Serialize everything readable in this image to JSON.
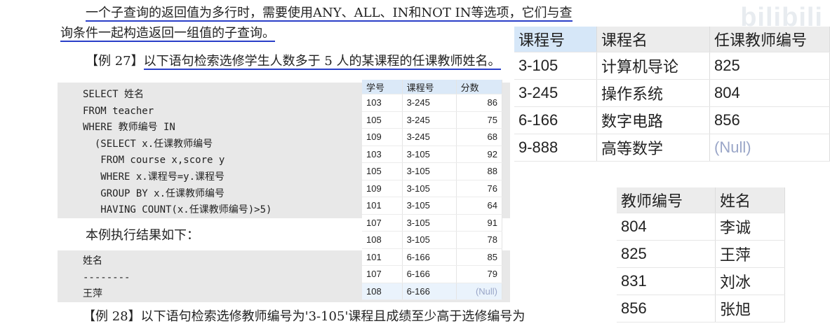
{
  "doc": {
    "para1_line1_a": "一个子查询的返回值为多行时，需要使用",
    "para1_line1_b": "ANY、ALL、IN和NOT IN",
    "para1_line1_c": "等选项，它们与查",
    "para1_line2": "询条件一起构造返回一组值的子查询。",
    "example_label": "【例 27】",
    "example_text": "以下语句检索选修学生人数多于 5 人的某课程的任课教师姓名。",
    "sql_lines": [
      "SELECT 姓名",
      "FROM teacher",
      "WHERE 教师编号 IN",
      "  (SELECT x.任课教师编号",
      "   FROM course x,score y",
      "   WHERE x.课程号=y.课程号",
      "   GROUP BY x.任课教师编号",
      "   HAVING COUNT(x.任课教师编号)>5)"
    ],
    "result_intro": "本例执行结果如下：",
    "result_lines": [
      "姓名",
      "--------",
      "王萍"
    ],
    "next_example_partial": "【例 28】以下语句检索选修教师编号为'3-105'课程且成绩至少高于选修编号为"
  },
  "score_table": {
    "headers": [
      "学号",
      "课程号",
      "分数"
    ],
    "rows": [
      [
        "103",
        "3-245",
        "86"
      ],
      [
        "105",
        "3-245",
        "75"
      ],
      [
        "109",
        "3-245",
        "68"
      ],
      [
        "103",
        "3-105",
        "92"
      ],
      [
        "105",
        "3-105",
        "88"
      ],
      [
        "109",
        "3-105",
        "76"
      ],
      [
        "101",
        "3-105",
        "64"
      ],
      [
        "107",
        "3-105",
        "91"
      ],
      [
        "108",
        "3-105",
        "78"
      ],
      [
        "101",
        "6-166",
        "85"
      ],
      [
        "107",
        "6-166",
        "79"
      ],
      [
        "108",
        "6-166",
        "(Null)"
      ]
    ]
  },
  "course_table": {
    "headers": [
      "课程号",
      "课程名",
      "任课教师编号"
    ],
    "rows": [
      [
        "3-105",
        "计算机导论",
        "825"
      ],
      [
        "3-245",
        "操作系统",
        "804"
      ],
      [
        "6-166",
        "数字电路",
        "856"
      ],
      [
        "9-888",
        "高等数学",
        "(Null)"
      ]
    ]
  },
  "teacher_table": {
    "headers": [
      "教师编号",
      "姓名"
    ],
    "rows": [
      [
        "804",
        "李诚"
      ],
      [
        "825",
        "王萍"
      ],
      [
        "831",
        "刘冰"
      ],
      [
        "856",
        "张旭"
      ]
    ]
  },
  "watermark": {
    "logo_text": "bilibili"
  }
}
